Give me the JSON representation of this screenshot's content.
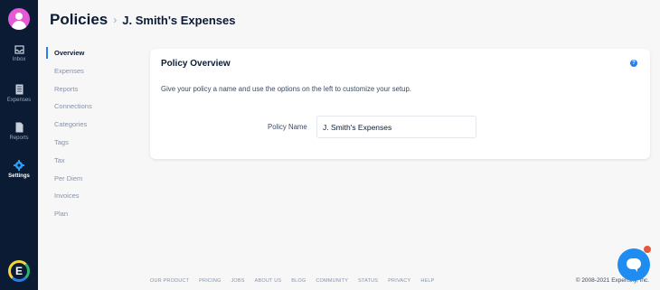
{
  "rail": {
    "items": [
      {
        "label": "Inbox",
        "icon": "inbox-icon"
      },
      {
        "label": "Expenses",
        "icon": "receipt-icon"
      },
      {
        "label": "Reports",
        "icon": "report-icon"
      },
      {
        "label": "Settings",
        "icon": "gear-icon"
      }
    ],
    "brand_letter": "E"
  },
  "breadcrumb": {
    "root": "Policies",
    "separator": "›",
    "current": "J. Smith's Expenses"
  },
  "nav": {
    "items": [
      "Overview",
      "Expenses",
      "Reports",
      "Connections",
      "Categories",
      "Tags",
      "Tax",
      "Per Diem",
      "Invoices",
      "Plan"
    ],
    "active": "Overview"
  },
  "card": {
    "title": "Policy Overview",
    "help": "?",
    "description": "Give your policy a name and use the options on the left to customize your setup.",
    "field_label": "Policy Name",
    "field_value": "J. Smith's Expenses"
  },
  "footer": {
    "links": [
      "OUR PRODUCT",
      "PRICING",
      "JOBS",
      "ABOUT US",
      "BLOG",
      "COMMUNITY",
      "STATUS",
      "PRIVACY",
      "HELP"
    ],
    "copyright": "© 2008-2021 Expensify, Inc."
  },
  "colors": {
    "rail": "#0b1b34",
    "accent": "#2a7df0",
    "avatar": "#e55ad6",
    "chat": "#1e8cf0",
    "notification": "#e4593c"
  }
}
